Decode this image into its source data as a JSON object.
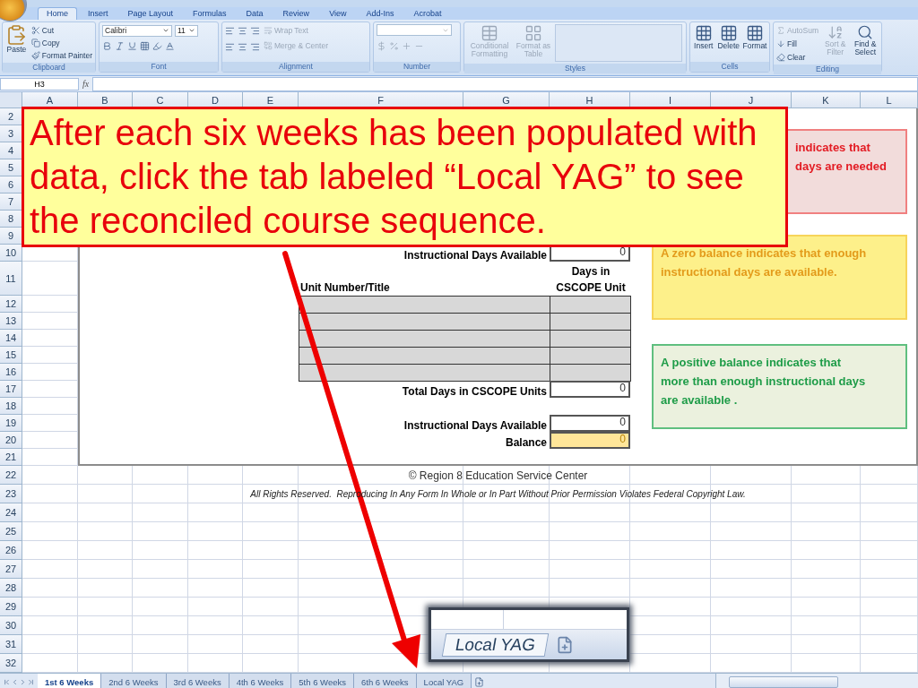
{
  "ribbon_tabs": [
    {
      "label": "Home",
      "selected": true
    },
    {
      "label": "Insert",
      "selected": false
    },
    {
      "label": "Page Layout",
      "selected": false
    },
    {
      "label": "Formulas",
      "selected": false
    },
    {
      "label": "Data",
      "selected": false
    },
    {
      "label": "Review",
      "selected": false
    },
    {
      "label": "View",
      "selected": false
    },
    {
      "label": "Add-Ins",
      "selected": false
    },
    {
      "label": "Acrobat",
      "selected": false
    }
  ],
  "ribbon_groups": [
    {
      "kind": "clipboard",
      "label": "Clipboard",
      "items": [
        {
          "label": "Paste",
          "disabled": false
        },
        {
          "label": "Cut",
          "disabled": false
        },
        {
          "label": "Copy",
          "disabled": false
        },
        {
          "label": "Format Painter",
          "disabled": false
        }
      ]
    },
    {
      "kind": "font",
      "label": "Font",
      "font": "Calibri",
      "size": "11"
    },
    {
      "kind": "alignment",
      "label": "Alignment",
      "items": [
        {
          "label": "Wrap Text",
          "disabled": true
        },
        {
          "label": "Merge & Center",
          "disabled": true
        }
      ]
    },
    {
      "kind": "number",
      "label": "Number"
    },
    {
      "kind": "styles",
      "label": "Styles",
      "items": [
        {
          "label": "Conditional Formatting",
          "disabled": true
        },
        {
          "label": "Format as Table",
          "disabled": true
        }
      ]
    },
    {
      "kind": "cells",
      "label": "Cells",
      "items": [
        {
          "label": "Insert",
          "disabled": false
        },
        {
          "label": "Delete",
          "disabled": false
        },
        {
          "label": "Format",
          "disabled": false
        }
      ]
    },
    {
      "kind": "editing",
      "label": "Editing",
      "items": [
        {
          "label": "AutoSum",
          "disabled": true
        },
        {
          "label": "Fill",
          "disabled": false
        },
        {
          "label": "Clear",
          "disabled": false
        },
        {
          "label": "Sort & Filter",
          "disabled": true
        },
        {
          "label": "Find & Select",
          "disabled": false
        }
      ]
    }
  ],
  "formula_bar": {
    "name_box": "H3",
    "fx": "fx"
  },
  "columns": [
    "A",
    "B",
    "C",
    "D",
    "E",
    "F",
    "G",
    "H",
    "I",
    "J",
    "K",
    "L"
  ],
  "rows": [
    "2",
    "3",
    "4",
    "5",
    "6",
    "7",
    "8",
    "9",
    "10",
    "11",
    "12",
    "13",
    "14",
    "15",
    "16",
    "17",
    "18",
    "19",
    "20",
    "21",
    "22",
    "23",
    "24",
    "25",
    "26",
    "27",
    "28",
    "29",
    "30",
    "31",
    "32"
  ],
  "form": {
    "available": {
      "label": "Instructional Days Available",
      "value": "0"
    },
    "unit_header": "Unit Number/Title",
    "days_header": "Days in CSCOPE Unit",
    "total": {
      "label": "Total Days in CSCOPE Units",
      "value": "0"
    },
    "available_2": {
      "label": "Instructional Days Available",
      "value": "0"
    },
    "balance": {
      "label": "Balance",
      "value": "0"
    }
  },
  "footer": {
    "copyright": "© Region 8 Education Service Center",
    "rights": "All Rights Reserved.  Reproducing In Any Form In Whole or In Part Without Prior Permission Violates Federal Copyright Law."
  },
  "legend_boxes": [
    {
      "kind": "negative",
      "lines": [
        "indicates that",
        "days are needed"
      ]
    },
    {
      "kind": "zero",
      "lines": [
        "A zero balance indicates that enough  instructional days are available."
      ]
    },
    {
      "kind": "positive",
      "lines": [
        "A positive balance indicates that more than enough instructional days are available ."
      ]
    }
  ],
  "callout": {
    "text": "After each six weeks has been populated with data, click the tab labeled “Local YAG” to see the reconciled course sequence."
  },
  "zoom_inset": {
    "tab": "Local YAG"
  },
  "sheet_tabs": [
    {
      "label": "1st 6 Weeks",
      "selected": true
    },
    {
      "label": "2nd 6 Weeks",
      "selected": false
    },
    {
      "label": "3rd 6 Weeks",
      "selected": false
    },
    {
      "label": "4th 6 Weeks",
      "selected": false
    },
    {
      "label": "5th 6 Weeks",
      "selected": false
    },
    {
      "label": "6th 6 Weeks",
      "selected": false
    },
    {
      "label": "Local YAG",
      "selected": false
    }
  ]
}
